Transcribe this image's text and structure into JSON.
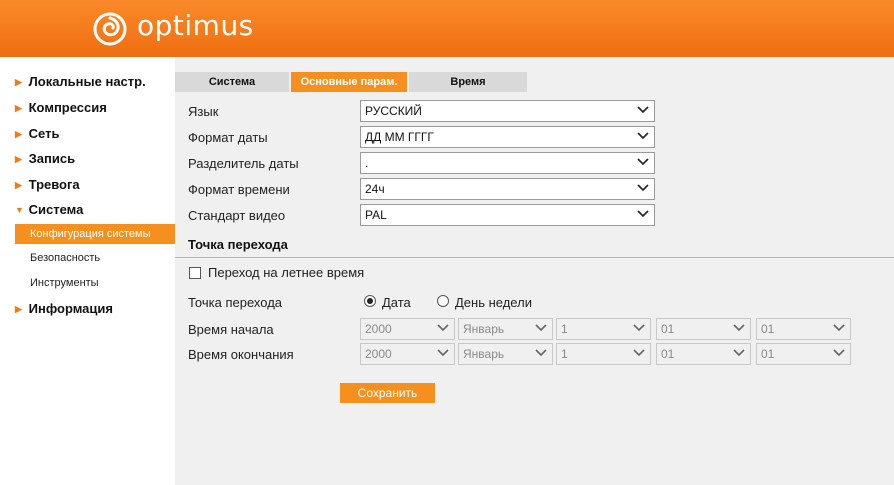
{
  "header": {
    "brand": "optimus",
    "brand_color": "#f47a17"
  },
  "sidebar": {
    "items": [
      {
        "label": "Локальные настр.",
        "arrow": "▶"
      },
      {
        "label": "Компрессия",
        "arrow": "▶"
      },
      {
        "label": "Сеть",
        "arrow": "▶"
      },
      {
        "label": "Запись",
        "arrow": "▶"
      },
      {
        "label": "Тревога",
        "arrow": "▶"
      },
      {
        "label": "Система",
        "arrow": "▼"
      },
      {
        "label": "Информация",
        "arrow": "▶"
      }
    ],
    "subitems": [
      {
        "label": "Конфигурация системы",
        "active": true
      },
      {
        "label": "Безопасность",
        "active": false
      },
      {
        "label": "Инструменты",
        "active": false
      }
    ]
  },
  "tabs": [
    {
      "label": "Система",
      "active": false
    },
    {
      "label": "Основные парам.",
      "active": true
    },
    {
      "label": "Время",
      "active": false
    }
  ],
  "form": {
    "language": {
      "label": "Язык",
      "value": "РУССКИЙ"
    },
    "date_format": {
      "label": "Формат даты",
      "value": "ДД ММ ГГГГ"
    },
    "date_separator": {
      "label": "Разделитель даты",
      "value": "."
    },
    "time_format": {
      "label": "Формат времени",
      "value": "24ч"
    },
    "video_standard": {
      "label": "Стандарт видео",
      "value": "PAL"
    }
  },
  "dst": {
    "section_title": "Точка перехода",
    "checkbox_label": "Переход на летнее время",
    "checkbox_checked": false,
    "transition_label": "Точка перехода",
    "radio_date": "Дата",
    "radio_weekday": "День недели",
    "selected": "date",
    "start_label": "Время начала",
    "end_label": "Время окончания",
    "start": {
      "year": "2000",
      "month": "Январь",
      "day": "1",
      "hour": "01",
      "minute": "01"
    },
    "end": {
      "year": "2000",
      "month": "Январь",
      "day": "1",
      "hour": "01",
      "minute": "01"
    }
  },
  "save_label": "Сохранить",
  "icons": {
    "chevron": "chevron-down-icon",
    "logo": "optimus-logo-icon"
  },
  "colors": {
    "accent": "#f5901e",
    "header_top": "#fb8a2a",
    "header_bottom": "#ee6e10",
    "panel_bg": "#f0f0f0"
  }
}
